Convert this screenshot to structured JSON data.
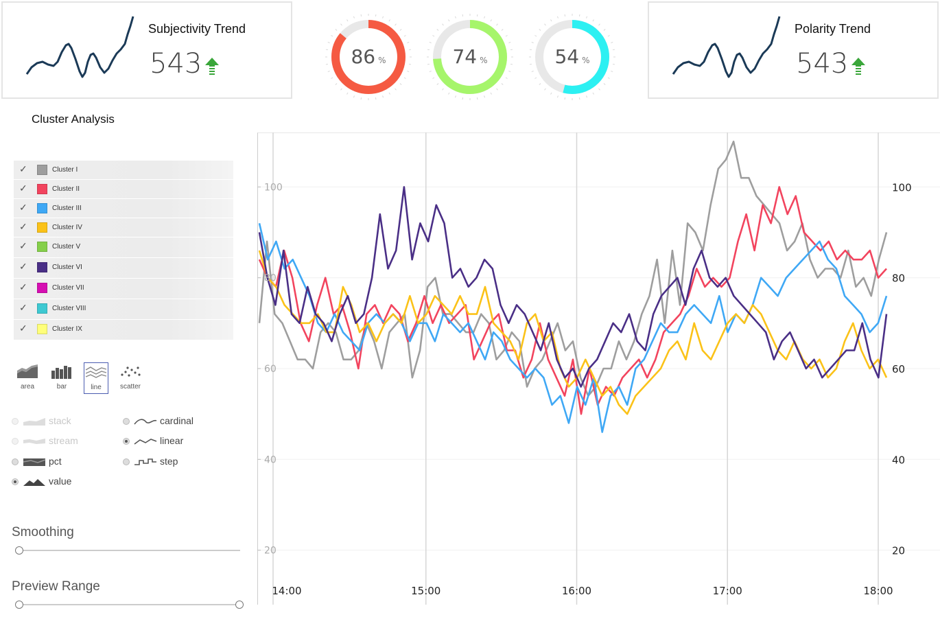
{
  "kpis": [
    {
      "title": "Subjectivity Trend",
      "value": "543",
      "trend": "up"
    },
    {
      "title": "Polarity Trend",
      "value": "543",
      "trend": "up"
    }
  ],
  "gauges": [
    {
      "value": "86",
      "unit": "%",
      "fraction": 0.86,
      "color": "#f55a42"
    },
    {
      "value": "74",
      "unit": "%",
      "fraction": 0.74,
      "color": "#a6f56b"
    },
    {
      "value": "54",
      "unit": "%",
      "fraction": 0.54,
      "color": "#2cf0f2"
    }
  ],
  "section_title": "Cluster Analysis",
  "legend": [
    {
      "label": "Cluster I",
      "color": "#9e9e9e"
    },
    {
      "label": "Cluster II",
      "color": "#f2445e"
    },
    {
      "label": "Cluster III",
      "color": "#3fa8f5"
    },
    {
      "label": "Cluster IV",
      "color": "#fbc218"
    },
    {
      "label": "Cluster V",
      "color": "#85cf4a"
    },
    {
      "label": "Cluster VI",
      "color": "#4a2f86"
    },
    {
      "label": "Cluster VII",
      "color": "#d60fb2"
    },
    {
      "label": "Cluster VIII",
      "color": "#3ec9d2"
    },
    {
      "label": "Cluster IX",
      "color": "#ffff7a"
    }
  ],
  "renderers": [
    {
      "label": "area",
      "icon": "area-chart-icon"
    },
    {
      "label": "bar",
      "icon": "bar-chart-icon"
    },
    {
      "label": "line",
      "icon": "line-chart-icon",
      "selected": true
    },
    {
      "label": "scatter",
      "icon": "scatter-chart-icon"
    }
  ],
  "offset_options": [
    {
      "label": "stack",
      "checked": false,
      "disabled": true
    },
    {
      "label": "stream",
      "checked": false,
      "disabled": true
    },
    {
      "label": "pct",
      "checked": false,
      "disabled": false
    },
    {
      "label": "value",
      "checked": true,
      "disabled": false
    }
  ],
  "interpolation_options": [
    {
      "label": "cardinal",
      "checked": false
    },
    {
      "label": "linear",
      "checked": true
    },
    {
      "label": "step",
      "checked": false
    }
  ],
  "smoothing": {
    "label": "Smoothing",
    "value": 0
  },
  "preview_range": {
    "label": "Preview Range",
    "from": 0,
    "to": 1
  },
  "chart_data": {
    "type": "line",
    "x_ticks": [
      "14:00",
      "15:00",
      "16:00",
      "17:00",
      "18:00"
    ],
    "y_ticks": [
      20,
      40,
      60,
      80,
      100
    ],
    "y_ticks_left": [
      20,
      40,
      60,
      80,
      100
    ],
    "ylim": [
      8,
      112
    ],
    "xlim": [
      "13:57",
      "18:00"
    ],
    "grid": true,
    "series": [
      {
        "color": "#9e9e9e",
        "values": [
          70,
          88,
          72,
          70,
          66,
          62,
          62,
          60,
          68,
          70,
          68,
          62,
          62,
          64,
          70,
          66,
          60,
          68,
          70,
          72,
          58,
          64,
          78,
          80,
          72,
          72,
          70,
          68,
          68,
          72,
          70,
          62,
          64,
          68,
          66,
          56,
          60,
          62,
          66,
          70,
          64,
          66,
          58,
          54,
          56,
          60,
          60,
          66,
          62,
          66,
          72,
          76,
          84,
          70,
          86,
          74,
          92,
          90,
          86,
          96,
          104,
          106,
          110,
          102,
          102,
          98,
          96,
          94,
          92,
          86,
          88,
          92,
          84,
          80,
          82,
          82,
          80,
          86,
          78,
          80,
          76,
          84,
          90
        ]
      },
      {
        "color": "#f2445e",
        "values": [
          84,
          80,
          78,
          86,
          80,
          70,
          66,
          74,
          80,
          72,
          74,
          68,
          60,
          72,
          74,
          70,
          74,
          72,
          66,
          70,
          76,
          70,
          74,
          70,
          72,
          74,
          62,
          66,
          70,
          72,
          64,
          64,
          58,
          62,
          70,
          62,
          58,
          54,
          62,
          50,
          60,
          52,
          56,
          54,
          58,
          60,
          62,
          58,
          62,
          68,
          70,
          72,
          76,
          82,
          78,
          80,
          78,
          80,
          88,
          94,
          86,
          96,
          92,
          100,
          94,
          98,
          90,
          88,
          86,
          88,
          84,
          86,
          84,
          84,
          86,
          80,
          82
        ]
      },
      {
        "color": "#3fa8f5",
        "values": [
          92,
          84,
          88,
          82,
          84,
          80,
          76,
          70,
          68,
          72,
          68,
          66,
          64,
          70,
          72,
          70,
          72,
          70,
          66,
          70,
          70,
          66,
          72,
          70,
          68,
          70,
          66,
          62,
          68,
          66,
          62,
          60,
          58,
          60,
          58,
          52,
          54,
          48,
          56,
          52,
          58,
          46,
          54,
          56,
          52,
          60,
          62,
          66,
          70,
          68,
          68,
          72,
          74,
          72,
          70,
          76,
          68,
          72,
          70,
          74,
          80,
          78,
          76,
          80,
          82,
          84,
          86,
          88,
          84,
          82,
          76,
          74,
          72,
          68,
          70,
          76
        ]
      },
      {
        "color": "#fbc218",
        "values": [
          86,
          80,
          78,
          74,
          72,
          70,
          70,
          72,
          68,
          68,
          78,
          74,
          68,
          70,
          66,
          70,
          72,
          70,
          76,
          70,
          72,
          76,
          74,
          72,
          76,
          72,
          72,
          78,
          70,
          68,
          66,
          62,
          70,
          72,
          66,
          68,
          60,
          56,
          58,
          62,
          58,
          54,
          56,
          52,
          50,
          54,
          56,
          58,
          60,
          64,
          66,
          62,
          70,
          64,
          62,
          66,
          70,
          72,
          70,
          74,
          72,
          68,
          64,
          62,
          66,
          62,
          60,
          62,
          58,
          60,
          66,
          70,
          64,
          60,
          62,
          58
        ]
      },
      {
        "color": "#4a2f86",
        "values": [
          90,
          80,
          74,
          86,
          72,
          70,
          78,
          72,
          70,
          66,
          72,
          76,
          70,
          72,
          80,
          94,
          82,
          86,
          100,
          84,
          92,
          88,
          96,
          92,
          80,
          82,
          78,
          80,
          84,
          82,
          74,
          70,
          74,
          72,
          68,
          64,
          70,
          62,
          58,
          60,
          56,
          60,
          62,
          66,
          70,
          68,
          72,
          66,
          64,
          72,
          76,
          78,
          80,
          74,
          82,
          86,
          80,
          78,
          80,
          76,
          74,
          72,
          70,
          68,
          62,
          66,
          68,
          64,
          60,
          62,
          58,
          60,
          62,
          64,
          64,
          70,
          62,
          58,
          72
        ]
      }
    ]
  }
}
